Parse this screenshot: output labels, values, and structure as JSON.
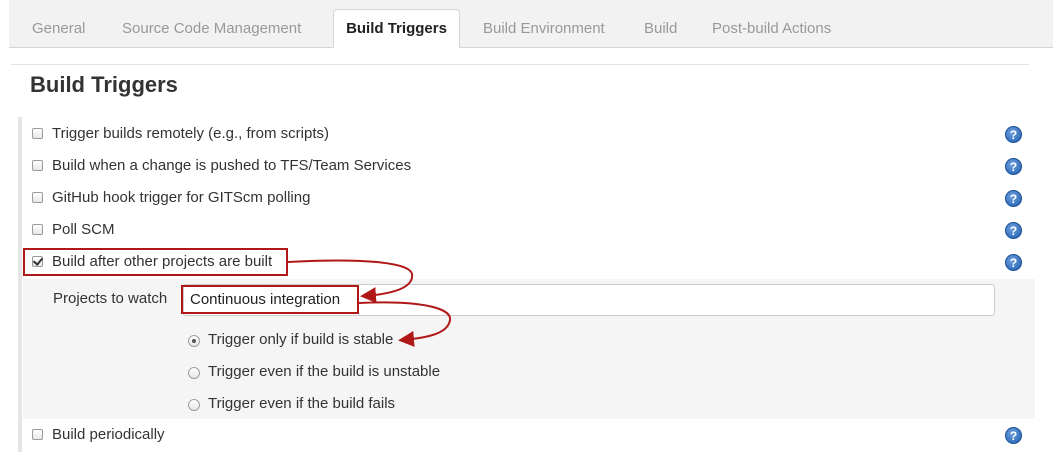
{
  "tabs": [
    {
      "label": "General",
      "active": false
    },
    {
      "label": "Source Code Management",
      "active": false
    },
    {
      "label": "Build Triggers",
      "active": true
    },
    {
      "label": "Build Environment",
      "active": false
    },
    {
      "label": "Build",
      "active": false
    },
    {
      "label": "Post-build Actions",
      "active": false
    }
  ],
  "section": {
    "title": "Build Triggers"
  },
  "triggers": [
    {
      "label": "Trigger builds remotely (e.g., from scripts)",
      "checked": false
    },
    {
      "label": "Build when a change is pushed to TFS/Team Services",
      "checked": false
    },
    {
      "label": "GitHub hook trigger for GITScm polling",
      "checked": false
    },
    {
      "label": "Poll SCM",
      "checked": false
    },
    {
      "label": "Build after other projects are built",
      "checked": true
    },
    {
      "label": "Build periodically",
      "checked": false
    }
  ],
  "build_after": {
    "projects_label": "Projects to watch",
    "projects_value": "Continuous integration",
    "options": [
      {
        "label": "Trigger only if build is stable",
        "selected": true
      },
      {
        "label": "Trigger even if the build is unstable",
        "selected": false
      },
      {
        "label": "Trigger even if the build fails",
        "selected": false
      }
    ]
  },
  "help_glyph": "?",
  "colors": {
    "annotation": "#b01818",
    "help": "#1f5fb0"
  }
}
